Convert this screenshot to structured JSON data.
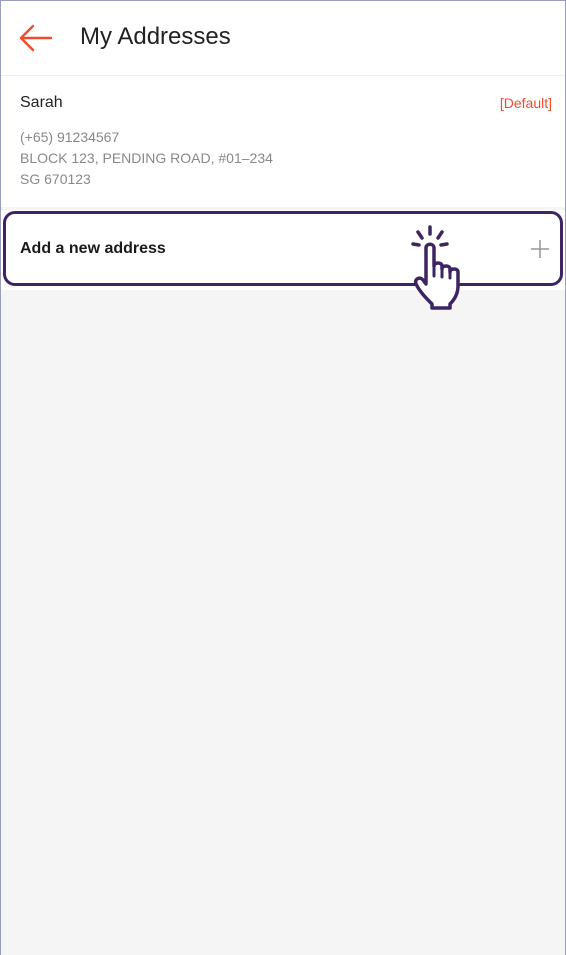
{
  "header": {
    "title": "My Addresses",
    "back_icon": "arrow-left-icon",
    "accent_color": "#ee4d2d"
  },
  "addresses": [
    {
      "name": "Sarah",
      "tag": "[Default]",
      "phone": "(+65) 91234567",
      "street": "BLOCK 123, PENDING ROAD, #01–234",
      "postal": "SG 670123"
    }
  ],
  "add_address": {
    "label": "Add a new address",
    "icon": "plus-icon"
  },
  "overlay": {
    "highlight_color": "#3d2563",
    "cursor_icon": "pointing-hand-tap-icon"
  }
}
